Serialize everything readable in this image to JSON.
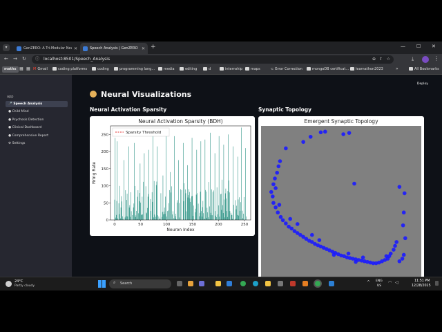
{
  "browser": {
    "tabs": [
      {
        "label": "GenZERO: A Tri-Modular Neuro",
        "active": false
      },
      {
        "label": "Speech Analysis | GenZERO",
        "active": true
      }
    ],
    "url": "localhost:8501/Speech_Analysis",
    "bookmarks": [
      "maths",
      "Gmail",
      "coding platforms",
      "coding",
      "programming lang...",
      "media",
      "editing",
      "d",
      "internship",
      "maps",
      "Error Correction",
      "mongoDB certificat...",
      "learnathon2023",
      "All Bookmarks"
    ]
  },
  "app": {
    "deploy_label": "Deploy",
    "sidebar": {
      "header": "app",
      "items": [
        {
          "label": "Speech Analysis",
          "active": true
        },
        {
          "label": "Child Mind",
          "active": false
        },
        {
          "label": "Psychosis Detection",
          "active": false
        },
        {
          "label": "Clinical Dashboard",
          "active": false
        },
        {
          "label": "Comprehensive Report",
          "active": false
        },
        {
          "label": "Settings",
          "active": false
        }
      ]
    },
    "page_title": "Neural Visualizations",
    "sections": {
      "left_heading": "Neural Activation Sparsity",
      "right_heading": "Synaptic Topology"
    }
  },
  "chart_data": [
    {
      "type": "bar",
      "title": "Neural Activation Sparsity (BDH)",
      "xlabel": "Neuron Index",
      "ylabel": "Firing Rate",
      "xlim": [
        -8,
        262
      ],
      "ylim": [
        0,
        275
      ],
      "xticks": [
        0,
        50,
        100,
        150,
        200,
        250
      ],
      "yticks": [
        0,
        50,
        100,
        150,
        200,
        250
      ],
      "legend": {
        "label": "Sparsity Threshold",
        "placement": "top-left",
        "style": "red dashed line"
      },
      "bar_color": "#1a8a7a",
      "series_note": "256 neurons, sparse firing rates",
      "tall_values": [
        {
          "x": 1,
          "y": 240
        },
        {
          "x": 5,
          "y": 230
        },
        {
          "x": 18,
          "y": 175
        },
        {
          "x": 27,
          "y": 215
        },
        {
          "x": 38,
          "y": 225
        },
        {
          "x": 49,
          "y": 165
        },
        {
          "x": 57,
          "y": 195
        },
        {
          "x": 66,
          "y": 205
        },
        {
          "x": 74,
          "y": 245
        },
        {
          "x": 82,
          "y": 215
        },
        {
          "x": 93,
          "y": 130
        },
        {
          "x": 99,
          "y": 255
        },
        {
          "x": 107,
          "y": 140
        },
        {
          "x": 115,
          "y": 245
        },
        {
          "x": 123,
          "y": 175
        },
        {
          "x": 132,
          "y": 225
        },
        {
          "x": 140,
          "y": 160
        },
        {
          "x": 149,
          "y": 240
        },
        {
          "x": 158,
          "y": 205
        },
        {
          "x": 166,
          "y": 230
        },
        {
          "x": 174,
          "y": 235
        },
        {
          "x": 184,
          "y": 255
        },
        {
          "x": 193,
          "y": 195
        },
        {
          "x": 201,
          "y": 245
        },
        {
          "x": 210,
          "y": 220
        },
        {
          "x": 219,
          "y": 250
        },
        {
          "x": 228,
          "y": 215
        },
        {
          "x": 237,
          "y": 185
        },
        {
          "x": 244,
          "y": 270
        },
        {
          "x": 252,
          "y": 210
        }
      ]
    },
    {
      "type": "scatter",
      "title": "Emergent Synaptic Topology",
      "background": "#808080",
      "marker_color": "#1a1aff",
      "points": [
        [
          -0.42,
          0.98
        ],
        [
          -0.28,
          1.05
        ],
        [
          -0.22,
          1.06
        ],
        [
          0.03,
          1.02
        ],
        [
          0.11,
          1.04
        ],
        [
          -0.52,
          0.9
        ],
        [
          -0.76,
          0.8
        ],
        [
          -0.86,
          0.52
        ],
        [
          -0.88,
          0.42
        ],
        [
          -0.91,
          0.33
        ],
        [
          -0.93,
          0.24
        ],
        [
          -0.96,
          0.12
        ],
        [
          -0.94,
          0.05
        ],
        [
          -0.93,
          -0.05
        ],
        [
          -0.9,
          -0.12
        ],
        [
          -0.87,
          -0.2
        ],
        [
          -0.83,
          -0.27
        ],
        [
          -0.8,
          -0.32
        ],
        [
          -0.76,
          -0.37
        ],
        [
          -0.72,
          -0.42
        ],
        [
          -0.68,
          -0.45
        ],
        [
          -0.64,
          -0.49
        ],
        [
          -0.6,
          -0.52
        ],
        [
          -0.56,
          -0.55
        ],
        [
          -0.52,
          -0.58
        ],
        [
          -0.48,
          -0.61
        ],
        [
          -0.44,
          -0.64
        ],
        [
          -0.4,
          -0.66
        ],
        [
          -0.36,
          -0.69
        ],
        [
          -0.32,
          -0.71
        ],
        [
          -0.28,
          -0.73
        ],
        [
          -0.24,
          -0.75
        ],
        [
          -0.2,
          -0.77
        ],
        [
          -0.16,
          -0.79
        ],
        [
          -0.12,
          -0.81
        ],
        [
          -0.08,
          -0.83
        ],
        [
          -0.04,
          -0.85
        ],
        [
          0.0,
          -0.87
        ],
        [
          0.04,
          -0.88
        ],
        [
          0.08,
          -0.9
        ],
        [
          0.12,
          -0.91
        ],
        [
          0.16,
          -0.92
        ],
        [
          0.2,
          -0.93
        ],
        [
          0.24,
          -0.94
        ],
        [
          0.28,
          -0.95
        ],
        [
          0.32,
          -0.96
        ],
        [
          0.36,
          -0.97
        ],
        [
          0.4,
          -0.98
        ],
        [
          0.44,
          -0.99
        ],
        [
          0.48,
          -0.99
        ],
        [
          0.52,
          -0.98
        ],
        [
          0.56,
          -0.96
        ],
        [
          0.6,
          -0.94
        ],
        [
          0.64,
          -0.92
        ],
        [
          0.66,
          -0.88
        ],
        [
          0.68,
          -0.84
        ],
        [
          0.72,
          -0.78
        ],
        [
          0.74,
          -0.72
        ],
        [
          0.76,
          -0.66
        ],
        [
          0.8,
          -0.96
        ],
        [
          0.84,
          -0.92
        ],
        [
          0.86,
          -0.86
        ],
        [
          0.88,
          -0.6
        ],
        [
          0.85,
          -0.4
        ],
        [
          0.87,
          0.1
        ],
        [
          0.8,
          0.2
        ],
        [
          0.86,
          -0.2
        ],
        [
          0.18,
          0.25
        ],
        [
          -0.4,
          -0.55
        ],
        [
          -0.6,
          -0.38
        ],
        [
          -0.3,
          -0.63
        ],
        [
          0.1,
          -0.84
        ],
        [
          0.3,
          -0.9
        ],
        [
          -0.7,
          -0.3
        ],
        [
          0.62,
          -0.88
        ],
        [
          0.2,
          -0.97
        ],
        [
          -0.1,
          -0.86
        ],
        [
          -0.85,
          -0.08
        ],
        [
          -0.9,
          0.18
        ],
        [
          -0.84,
          0.6
        ]
      ]
    }
  ],
  "taskbar": {
    "weather_temp": "24°C",
    "weather_desc": "Partly cloudy",
    "search_label": "Search",
    "lang_top": "ENG",
    "lang_bottom": "US",
    "time": "11:51 PM",
    "date": "12/28/2025"
  }
}
